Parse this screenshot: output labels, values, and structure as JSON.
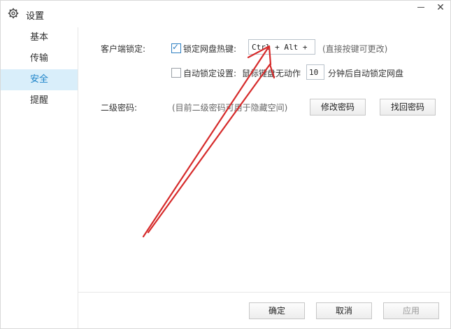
{
  "window": {
    "title": "设置",
    "icon": "gear-icon",
    "minimize_icon": "minimize-icon",
    "close_glyph": "✕"
  },
  "sidebar": {
    "items": [
      {
        "label": "基本",
        "active": false
      },
      {
        "label": "传输",
        "active": false
      },
      {
        "label": "安全",
        "active": true
      },
      {
        "label": "提醒",
        "active": false
      }
    ]
  },
  "security": {
    "client_lock_label": "客户端锁定:",
    "hotkey_checkbox_label": "锁定网盘热键:",
    "hotkey_checked": true,
    "hotkey_value": "Ctrl + Alt + Y",
    "hotkey_hint": "(直接按键可更改)",
    "autolock_checkbox_label": "自动锁定设置:",
    "autolock_checked": false,
    "autolock_prefix": "鼠标键盘无动作",
    "autolock_minutes": "10",
    "autolock_suffix": "分钟后自动锁定网盘",
    "second_password_label": "二级密码:",
    "second_password_hint": "(目前二级密码可用于隐藏空间)",
    "change_password_button": "修改密码",
    "recover_password_button": "找回密码"
  },
  "footer": {
    "ok_button": "确定",
    "cancel_button": "取消",
    "apply_button": "应用"
  },
  "colors": {
    "accent": "#1b82c8",
    "active_bg": "#d9eefa",
    "annotation_arrow": "#d62b2b"
  }
}
